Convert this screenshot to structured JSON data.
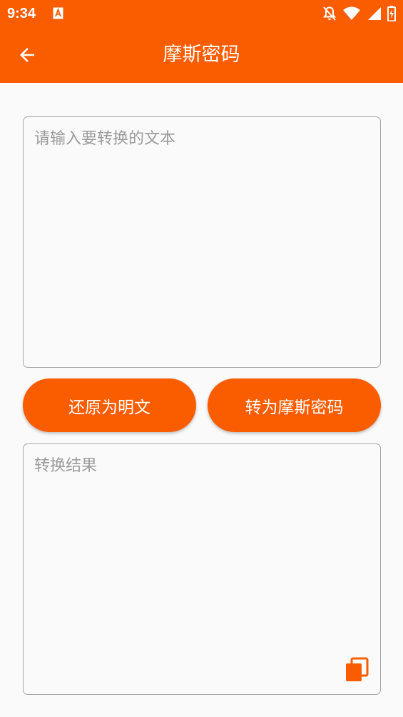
{
  "status_bar": {
    "time": "9:34",
    "icons": [
      "app-notification-icon",
      "notifications-off-icon",
      "wifi-icon",
      "cellular-signal-icon",
      "battery-charging-icon"
    ]
  },
  "toolbar": {
    "title": "摩斯密码",
    "back_icon": "arrow-back-icon"
  },
  "input": {
    "placeholder": "请输入要转换的文本",
    "value": ""
  },
  "buttons": {
    "restore_label": "还原为明文",
    "convert_label": "转为摩斯密码"
  },
  "output": {
    "placeholder": "转换结果",
    "value": "",
    "copy_icon": "copy-icon"
  },
  "colors": {
    "accent": "#fa5c00",
    "background": "#fafafa",
    "border": "#a6a6a6",
    "placeholder": "#9b9b9b"
  }
}
